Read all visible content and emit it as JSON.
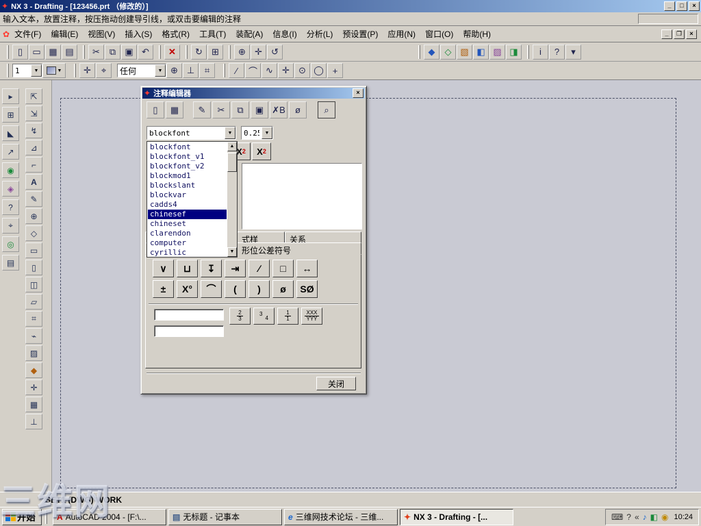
{
  "window": {
    "title": "NX 3 - Drafting - [123456.prt （修改的）]",
    "minimize": "_",
    "maximize": "□",
    "close": "×"
  },
  "prompt_bar": {
    "text": "输入文本，放置注释，按压拖动创建导引线，或双击要编辑的注释",
    "status_field": ""
  },
  "menu_bar": {
    "items": [
      "文件(F)",
      "编辑(E)",
      "视图(V)",
      "插入(S)",
      "格式(R)",
      "工具(T)",
      "装配(A)",
      "信息(I)",
      "分析(L)",
      "预设置(P)",
      "应用(N)",
      "窗口(O)",
      "帮助(H)"
    ]
  },
  "toolbar_main": {
    "group_file": [
      {
        "name": "new-icon",
        "glyph": "▯"
      },
      {
        "name": "open-icon",
        "glyph": "▭"
      },
      {
        "name": "save-icon",
        "glyph": "▦"
      },
      {
        "name": "print-icon",
        "glyph": "▤"
      }
    ],
    "group_edit": [
      {
        "name": "cut-icon",
        "glyph": "✂"
      },
      {
        "name": "copy-icon",
        "glyph": "⧉"
      },
      {
        "name": "paste-icon",
        "glyph": "▣"
      },
      {
        "name": "undo-icon",
        "glyph": "↶"
      }
    ],
    "group_delete": [
      {
        "name": "delete-icon",
        "glyph": "✕"
      }
    ],
    "group_refresh": [
      {
        "name": "refresh-icon",
        "glyph": "↻"
      },
      {
        "name": "fit-view-icon",
        "glyph": "⊞"
      }
    ],
    "group_view": [
      {
        "name": "zoom-icon",
        "glyph": "⊕"
      },
      {
        "name": "pan-icon",
        "glyph": "✛"
      },
      {
        "name": "rotate-icon",
        "glyph": "↺"
      }
    ],
    "group_apps": [
      {
        "name": "shaded-view-icon",
        "glyph": "◆"
      },
      {
        "name": "wireframe-view-icon",
        "glyph": "◇"
      },
      {
        "name": "layers-icon",
        "glyph": "▧"
      },
      {
        "name": "modeling-app-icon",
        "glyph": "◧"
      },
      {
        "name": "drafting-app-icon",
        "glyph": "▨"
      },
      {
        "name": "assembly-app-icon",
        "glyph": "◨"
      }
    ],
    "group_right": [
      {
        "name": "info-icon",
        "glyph": "i"
      },
      {
        "name": "help-icon",
        "glyph": "?"
      },
      {
        "name": "customize-icon",
        "glyph": "▾"
      }
    ]
  },
  "toolbar_second": {
    "sheet_value": "1",
    "filter_value": "任何",
    "icons_a": [
      {
        "name": "move-icon",
        "glyph": "✛"
      },
      {
        "name": "position-icon",
        "glyph": "⌖"
      }
    ],
    "icons_b": [
      {
        "name": "snap-point-icon",
        "glyph": "⊕"
      },
      {
        "name": "constraint-icon",
        "glyph": "⊥"
      },
      {
        "name": "align-icon",
        "glyph": "⌗"
      }
    ],
    "curves": [
      {
        "name": "line-icon",
        "glyph": "∕"
      },
      {
        "name": "arc-icon",
        "glyph": "⌒"
      },
      {
        "name": "spline-icon",
        "glyph": "∿"
      },
      {
        "name": "point-icon",
        "glyph": "✛"
      },
      {
        "name": "circle-icon",
        "glyph": "⊙"
      },
      {
        "name": "ellipse-icon",
        "glyph": "◯"
      },
      {
        "name": "plus-icon",
        "glyph": "+"
      }
    ]
  },
  "left_toolbar": {
    "col1": [
      {
        "name": "dock-tool-1-icon",
        "glyph": "▸"
      },
      {
        "name": "dock-tool-2-icon",
        "glyph": "⊞"
      },
      {
        "name": "dock-tool-3-icon",
        "glyph": "◣"
      },
      {
        "name": "dock-tool-4-icon",
        "glyph": "↗"
      },
      {
        "name": "dock-tool-5-icon",
        "glyph": "◉"
      },
      {
        "name": "dock-tool-6-icon",
        "glyph": "◈"
      },
      {
        "name": "dock-help-icon",
        "glyph": "?"
      },
      {
        "name": "dock-tool-8-icon",
        "glyph": "⌖"
      },
      {
        "name": "dock-tool-9-icon",
        "glyph": "◎"
      },
      {
        "name": "dock-tool-10-icon",
        "glyph": "▤"
      }
    ],
    "col2": [
      {
        "name": "draft-tool-1-icon",
        "glyph": "⇱"
      },
      {
        "name": "draft-tool-2-icon",
        "glyph": "⇲"
      },
      {
        "name": "draft-tool-3-icon",
        "glyph": "↯"
      },
      {
        "name": "draft-tool-4-icon",
        "glyph": "⊿"
      },
      {
        "name": "draft-tool-5-icon",
        "glyph": "⌐"
      },
      {
        "name": "draft-text-icon",
        "glyph": "A"
      },
      {
        "name": "draft-edit-icon",
        "glyph": "✎"
      },
      {
        "name": "draft-tool-8-icon",
        "glyph": "⊕"
      },
      {
        "name": "draft-tool-9-icon",
        "glyph": "◇"
      },
      {
        "name": "draft-tool-10-icon",
        "glyph": "▭"
      },
      {
        "name": "draft-tool-11-icon",
        "glyph": "▯"
      },
      {
        "name": "draft-tool-12-icon",
        "glyph": "◫"
      },
      {
        "name": "draft-tool-13-icon",
        "glyph": "▱"
      },
      {
        "name": "draft-tool-14-icon",
        "glyph": "⌗"
      },
      {
        "name": "draft-tool-15-icon",
        "glyph": "⌁"
      },
      {
        "name": "draft-tool-16-icon",
        "glyph": "▨"
      },
      {
        "name": "draft-tool-17-icon",
        "glyph": "◆"
      },
      {
        "name": "draft-tool-18-icon",
        "glyph": "✛"
      },
      {
        "name": "draft-tool-19-icon",
        "glyph": "▦"
      },
      {
        "name": "draft-tool-20-icon",
        "glyph": "⊥"
      }
    ]
  },
  "dialog": {
    "title": "注释编辑器",
    "close": "×",
    "toolbar": [
      {
        "name": "new-text-icon",
        "glyph": "▯"
      },
      {
        "name": "save-text-icon",
        "glyph": "▦"
      },
      {
        "name": "edit-text-icon",
        "glyph": "✎"
      },
      {
        "name": "cut-icon",
        "glyph": "✂"
      },
      {
        "name": "copy-icon",
        "glyph": "⧉"
      },
      {
        "name": "paste-icon",
        "glyph": "▣"
      },
      {
        "name": "clear-format-icon",
        "glyph": "✗B"
      },
      {
        "name": "insert-symbol-icon",
        "glyph": "ø"
      },
      {
        "name": "preview-icon",
        "glyph": "⌕"
      }
    ],
    "font_value": "blockfont",
    "size_value": "0.25",
    "font_list": [
      "blockfont",
      "blockfont_v1",
      "blockfont_v2",
      "blockmod1",
      "blockslant",
      "blockvar",
      "cadds4",
      "chinesef",
      "chineset",
      "clarendon",
      "computer",
      "cyrillic"
    ],
    "selected_font": "chinesef",
    "scroll_up": "▲",
    "scroll_down": "▼",
    "sup_base": "X",
    "sup_script": "2",
    "sub_base": "X",
    "sub_script": "2",
    "text_content": "",
    "hidden_tab": "",
    "tab_style": "式样",
    "tab_relation": "关系",
    "tab_active": "形位公差符号",
    "symbols_row1": [
      "∨",
      "⊔",
      "↧",
      "⇥",
      "∕",
      "□",
      "↔"
    ],
    "symbols_row2": [
      "±",
      "X°",
      "⌒",
      "(",
      ")",
      "ø",
      "SØ"
    ],
    "input1": "",
    "input2": "",
    "fractions": [
      {
        "top": "2",
        "bottom": "3",
        "style": "stacked"
      },
      {
        "top": "3",
        "bottom": "4",
        "style": "diagonal"
      },
      {
        "top": "1",
        "bottom": "1",
        "style": "stacked"
      },
      {
        "top": "XXX",
        "bottom": "YYY",
        "style": "stacked"
      }
    ],
    "close_label": "关闭"
  },
  "status_bar": {
    "text": "SET1 (DWG) WORK"
  },
  "taskbar": {
    "start_label": "开始",
    "tasks": [
      {
        "icon": "A",
        "label": "AutoCAD 2004 - [F:\\..."
      },
      {
        "icon": "▤",
        "label": "无标题 - 记事本"
      },
      {
        "icon": "e",
        "label": "三维网技术论坛 - 三维..."
      },
      {
        "icon": "✦",
        "label": "NX 3 - Drafting - [..."
      }
    ],
    "active_index": 3,
    "tray_icons": [
      {
        "name": "keyboard-icon",
        "glyph": "⌨"
      },
      {
        "name": "help-icon",
        "glyph": "?"
      },
      {
        "name": "collapse-icon",
        "glyph": "«"
      },
      {
        "name": "volume-icon",
        "glyph": "♪"
      },
      {
        "name": "network-icon",
        "glyph": "◧"
      },
      {
        "name": "monitor-icon",
        "glyph": "◉"
      }
    ],
    "clock": "10:24"
  },
  "watermark": {
    "text": "三维网"
  },
  "colors": {
    "title_gradient_start": "#0a246a",
    "title_gradient_end": "#a6caf0",
    "chrome": "#d4d0c8",
    "canvas": "#c9cad3",
    "selection": "#000080"
  }
}
